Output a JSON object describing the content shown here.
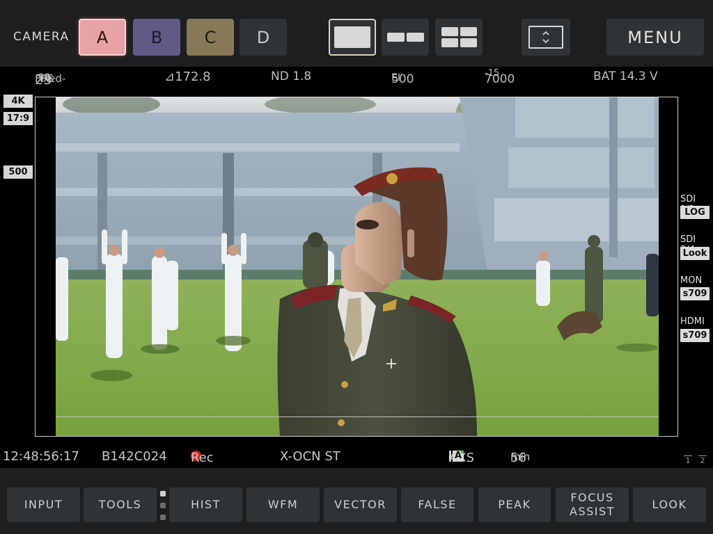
{
  "header": {
    "camera_label": "CAMERA",
    "cameras": [
      "A",
      "B",
      "C",
      "D"
    ],
    "active_camera": "A",
    "menu_label": "MENU",
    "colors": {
      "cam_a": "#e7a2a6",
      "cam_b": "#5f5a86",
      "cam_c": "#857958",
      "cam_d": "#303335"
    }
  },
  "status": {
    "fps_prefix": "Fixed-",
    "fps_int": "23",
    "fps_frac": ".98",
    "fps_unit": " FPS",
    "shutter": "⊿172.8",
    "nd": "ND 1.8",
    "ei_value": "500",
    "ei_unit": " EI",
    "wb_kelvin": "7000",
    "wb_tint": "-15",
    "battery": "BAT 14.3 V"
  },
  "left_tags": {
    "resolution": "4K",
    "aspect": "17:9",
    "ei": "500"
  },
  "outputs": [
    {
      "label": "SDI 1/2",
      "value": "LOG"
    },
    {
      "label": "SDI 3/4",
      "value": "Look"
    },
    {
      "label": "MON",
      "value": "s709"
    },
    {
      "label": "HDMI",
      "value": "s709"
    }
  ],
  "footer_info": {
    "timecode": "12:48:56:17",
    "clip": "B142C024",
    "rec": "Rec",
    "codec": "X-OCN ST",
    "media": "AXS",
    "media_slot": "A",
    "remaining_value": "56",
    "remaining_unit": " min",
    "slot_1": "1",
    "slot_2": "2"
  },
  "tools": {
    "input": "INPUT",
    "tools": "TOOLS",
    "hist": "HIST",
    "wfm": "WFM",
    "vector": "VECTOR",
    "false": "FALSE",
    "peak": "PEAK",
    "focus_line1": "FOCUS",
    "focus_line2": "ASSIST",
    "look": "LOOK"
  },
  "rec_color": "#e02424"
}
